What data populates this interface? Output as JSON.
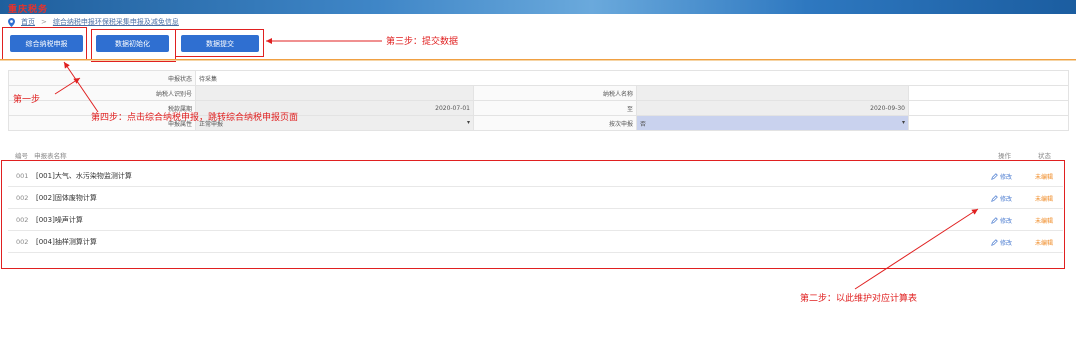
{
  "header": {
    "logo_text": "重庆税务",
    "breadcrumb": {
      "home": "首页",
      "separator": ">",
      "current": "综合纳税申报环保税采集申报及减免信息"
    }
  },
  "toolbar": {
    "btn_declare": "综合纳税申报",
    "btn_init": "数据初始化",
    "btn_submit": "数据提交"
  },
  "form": {
    "status_label": "申报状态",
    "status_value": "待采集",
    "taxpayer_id_label": "纳税人识别号",
    "taxpayer_id_value": "",
    "taxpayer_name_label": "纳税人名称",
    "taxpayer_name_value": "",
    "period_label": "税款属期",
    "period_start": "2020-07-01",
    "period_to": "至",
    "period_end": "2020-09-30",
    "attr_label": "申报属性",
    "attr_value": "正常申报",
    "by_time_label": "按次申报",
    "by_time_value": "否"
  },
  "list": {
    "col_no": "编号",
    "col_name": "申报表名称",
    "col_op": "操作",
    "col_state": "状态",
    "rows": [
      {
        "no": "001",
        "name": "[001]大气、水污染物监测计算",
        "op": "修改",
        "state": "未编辑"
      },
      {
        "no": "002",
        "name": "[002]固体废物计算",
        "op": "修改",
        "state": "未编辑"
      },
      {
        "no": "002",
        "name": "[003]噪声计算",
        "op": "修改",
        "state": "未编辑"
      },
      {
        "no": "002",
        "name": "[004]抽样测算计算",
        "op": "修改",
        "state": "未编辑"
      }
    ]
  },
  "annotations": {
    "step1": "第一步",
    "step2": "第二步：以此维护对应计算表",
    "step3": "第三步：提交数据",
    "step4": "第四步：点击综合纳税申报，跳转综合纳税申报页面"
  },
  "colors": {
    "primary_button": "#2f6fd1",
    "annotation": "#e02020",
    "state_unedited": "#f08a24",
    "divider": "#f0a042"
  }
}
